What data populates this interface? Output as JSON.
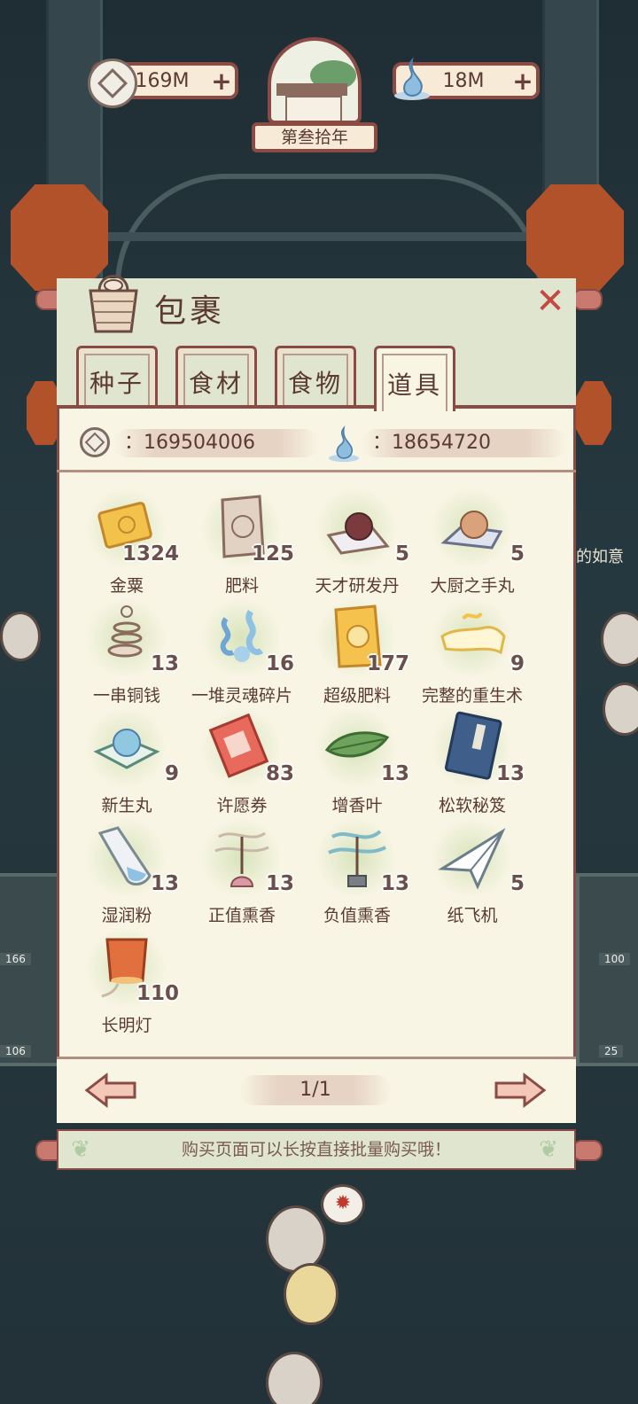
{
  "hud": {
    "coins": "169M",
    "souls": "18M",
    "plus": "+",
    "year": "第叁拾年"
  },
  "panel": {
    "title": "包裹",
    "close": "✕",
    "tabs": [
      {
        "label": "种子",
        "active": false
      },
      {
        "label": "食材",
        "active": false
      },
      {
        "label": "食物",
        "active": false
      },
      {
        "label": "道具",
        "active": true
      }
    ],
    "coin_total": "：169504006",
    "soul_total": "：18654720",
    "page": "1/1"
  },
  "items": [
    {
      "name": "金粟",
      "count": "1324",
      "icon": "gold-ticket-icon"
    },
    {
      "name": "肥料",
      "count": "125",
      "icon": "fertilizer-bag-icon"
    },
    {
      "name": "天才研发丹",
      "count": "5",
      "icon": "genius-pill-icon"
    },
    {
      "name": "大厨之手丸",
      "count": "5",
      "icon": "chef-pill-icon"
    },
    {
      "name": "一串铜钱",
      "count": "13",
      "icon": "coin-string-icon"
    },
    {
      "name": "一堆灵魂碎片",
      "count": "16",
      "icon": "soul-fragments-icon"
    },
    {
      "name": "超级肥料",
      "count": "177",
      "icon": "super-fertilizer-icon"
    },
    {
      "name": "完整的重生术",
      "count": "9",
      "icon": "rebirth-scroll-icon"
    },
    {
      "name": "新生丸",
      "count": "9",
      "icon": "newborn-pill-icon"
    },
    {
      "name": "许愿券",
      "count": "83",
      "icon": "wish-ticket-icon"
    },
    {
      "name": "增香叶",
      "count": "13",
      "icon": "aroma-leaf-icon"
    },
    {
      "name": "松软秘笈",
      "count": "13",
      "icon": "secret-book-icon"
    },
    {
      "name": "湿润粉",
      "count": "13",
      "icon": "moist-powder-icon"
    },
    {
      "name": "正值熏香",
      "count": "13",
      "icon": "positive-incense-icon"
    },
    {
      "name": "负值熏香",
      "count": "13",
      "icon": "negative-incense-icon"
    },
    {
      "name": "纸飞机",
      "count": "5",
      "icon": "paper-plane-icon"
    },
    {
      "name": "长明灯",
      "count": "110",
      "icon": "sky-lantern-icon"
    }
  ],
  "tip": "购买页面可以长按直接批量购买哦！",
  "background": {
    "stall_left_top": "166",
    "stall_left_bottom": "106",
    "stall_right_top": "100",
    "stall_right_bottom": "25",
    "side_text": "的如意"
  },
  "colors": {
    "border": "#8a4b45",
    "panel_bg": "#f8f5e4",
    "header_bg": "#dfe5cf",
    "text": "#5a3a32"
  }
}
